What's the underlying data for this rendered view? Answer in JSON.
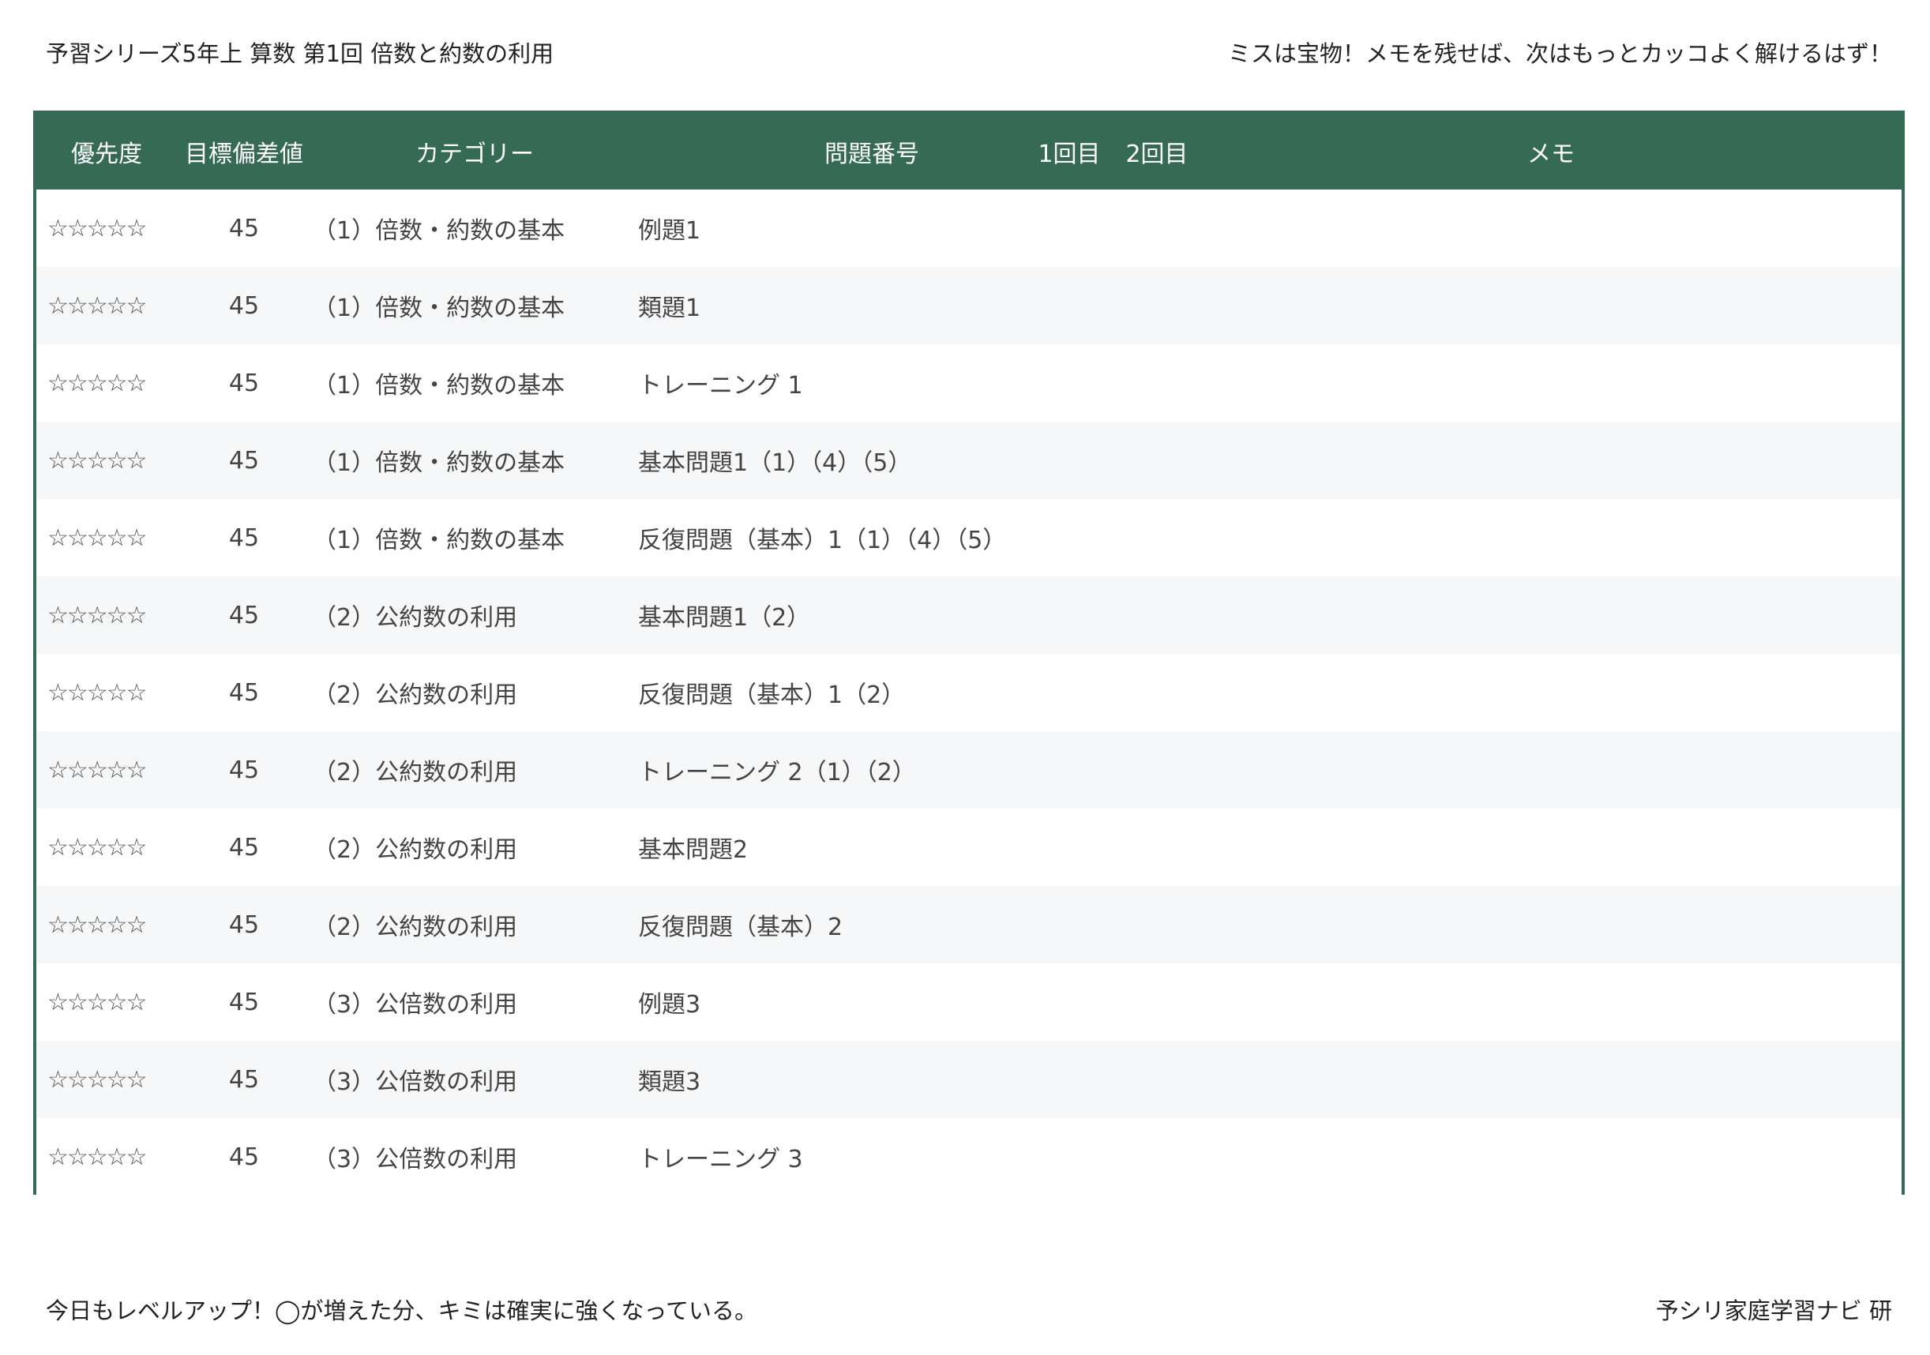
{
  "header": {
    "title": "予習シリーズ5年上 算数 第1回 倍数と約数の利用",
    "motto": "ミスは宝物！メモを残せば、次はもっとカッコよく解けるはず！"
  },
  "table": {
    "columns": {
      "priority": "優先度",
      "target_deviation": "目標偏差値",
      "category": "カテゴリー",
      "problem_number": "問題番号",
      "round1": "1回目",
      "round2": "2回目",
      "memo": "メモ"
    },
    "rows": [
      {
        "priority": "☆☆☆☆☆",
        "deviation": "45",
        "category": "（1）倍数・約数の基本",
        "problem": "例題1"
      },
      {
        "priority": "☆☆☆☆☆",
        "deviation": "45",
        "category": "（1）倍数・約数の基本",
        "problem": "類題1"
      },
      {
        "priority": "☆☆☆☆☆",
        "deviation": "45",
        "category": "（1）倍数・約数の基本",
        "problem": "トレーニング 1"
      },
      {
        "priority": "☆☆☆☆☆",
        "deviation": "45",
        "category": "（1）倍数・約数の基本",
        "problem": "基本問題1（1）（4）（5）"
      },
      {
        "priority": "☆☆☆☆☆",
        "deviation": "45",
        "category": "（1）倍数・約数の基本",
        "problem": "反復問題（基本）1（1）（4）（5）"
      },
      {
        "priority": "☆☆☆☆☆",
        "deviation": "45",
        "category": "（2）公約数の利用",
        "problem": "基本問題1（2）"
      },
      {
        "priority": "☆☆☆☆☆",
        "deviation": "45",
        "category": "（2）公約数の利用",
        "problem": "反復問題（基本）1（2）"
      },
      {
        "priority": "☆☆☆☆☆",
        "deviation": "45",
        "category": "（2）公約数の利用",
        "problem": "トレーニング 2（1）（2）"
      },
      {
        "priority": "☆☆☆☆☆",
        "deviation": "45",
        "category": "（2）公約数の利用",
        "problem": "基本問題2"
      },
      {
        "priority": "☆☆☆☆☆",
        "deviation": "45",
        "category": "（2）公約数の利用",
        "problem": "反復問題（基本）2"
      },
      {
        "priority": "☆☆☆☆☆",
        "deviation": "45",
        "category": "（3）公倍数の利用",
        "problem": "例題3"
      },
      {
        "priority": "☆☆☆☆☆",
        "deviation": "45",
        "category": "（3）公倍数の利用",
        "problem": "類題3"
      },
      {
        "priority": "☆☆☆☆☆",
        "deviation": "45",
        "category": "（3）公倍数の利用",
        "problem": "トレーニング 3"
      }
    ]
  },
  "footer": {
    "encouragement": "今日もレベルアップ！◯が増えた分、キミは確実に強くなっている。",
    "credit": "予シリ家庭学習ナビ 研"
  },
  "colors": {
    "header_green": "#356a55",
    "row_alt": "#f6f7f8"
  }
}
